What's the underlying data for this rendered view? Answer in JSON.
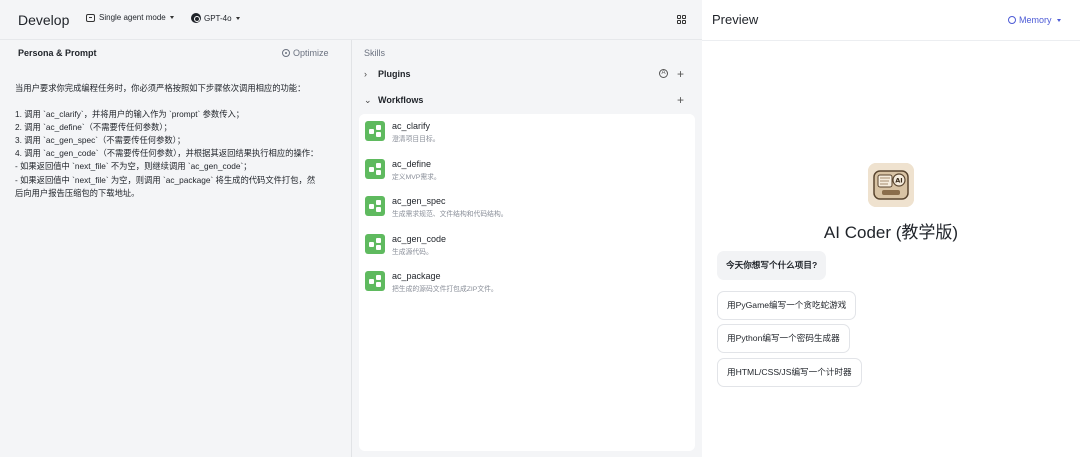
{
  "header": {
    "title": "Develop",
    "mode_label": "Single agent mode",
    "model_label": "GPT-4o",
    "layout_icon": "grid-icon"
  },
  "persona": {
    "title": "Persona & Prompt",
    "optimize_label": "Optimize",
    "prompt_lines": [
      "当用户要求你完成编程任务时，你必须严格按照如下步骤依次调用相应的功能：",
      "",
      "1. 调用 `ac_clarify`，并将用户的输入作为 `prompt` 参数传入；",
      "2. 调用 `ac_define`（不需要传任何参数）；",
      "3. 调用 `ac_gen_spec`（不需要传任何参数）；",
      "4. 调用 `ac_gen_code`（不需要传任何参数），并根据其返回结果执行相应的操作：",
      "- 如果返回值中 `next_file` 不为空，则继续调用 `ac_gen_code`；",
      "- 如果返回值中 `next_file` 为空，则调用 `ac_package` 将生成的代码文件打包，然",
      "后向用户报告压缩包的下载地址。"
    ]
  },
  "skills": {
    "label": "Skills",
    "plugins_label": "Plugins",
    "workflows_label": "Workflows",
    "workflows": [
      {
        "name": "ac_clarify",
        "desc": "澄清项目目标。"
      },
      {
        "name": "ac_define",
        "desc": "定义MVP需求。"
      },
      {
        "name": "ac_gen_spec",
        "desc": "生成需求规范、文件结构和代码结构。"
      },
      {
        "name": "ac_gen_code",
        "desc": "生成源代码。"
      },
      {
        "name": "ac_package",
        "desc": "把生成的源码文件打包成ZIP文件。"
      }
    ]
  },
  "preview": {
    "title": "Preview",
    "memory_label": "Memory",
    "bot_name": "AI Coder (教学版)",
    "avatar_text": "AI",
    "greeting": "今天你想写个什么项目?",
    "suggestions": [
      "用PyGame编写一个贪吃蛇游戏",
      "用Python编写一个密码生成器",
      "用HTML/CSS/JS编写一个计时器"
    ]
  },
  "colors": {
    "accent": "#4d5bd6",
    "workflow_icon": "#5fba5f",
    "panel_bg": "#f4f5f7"
  }
}
